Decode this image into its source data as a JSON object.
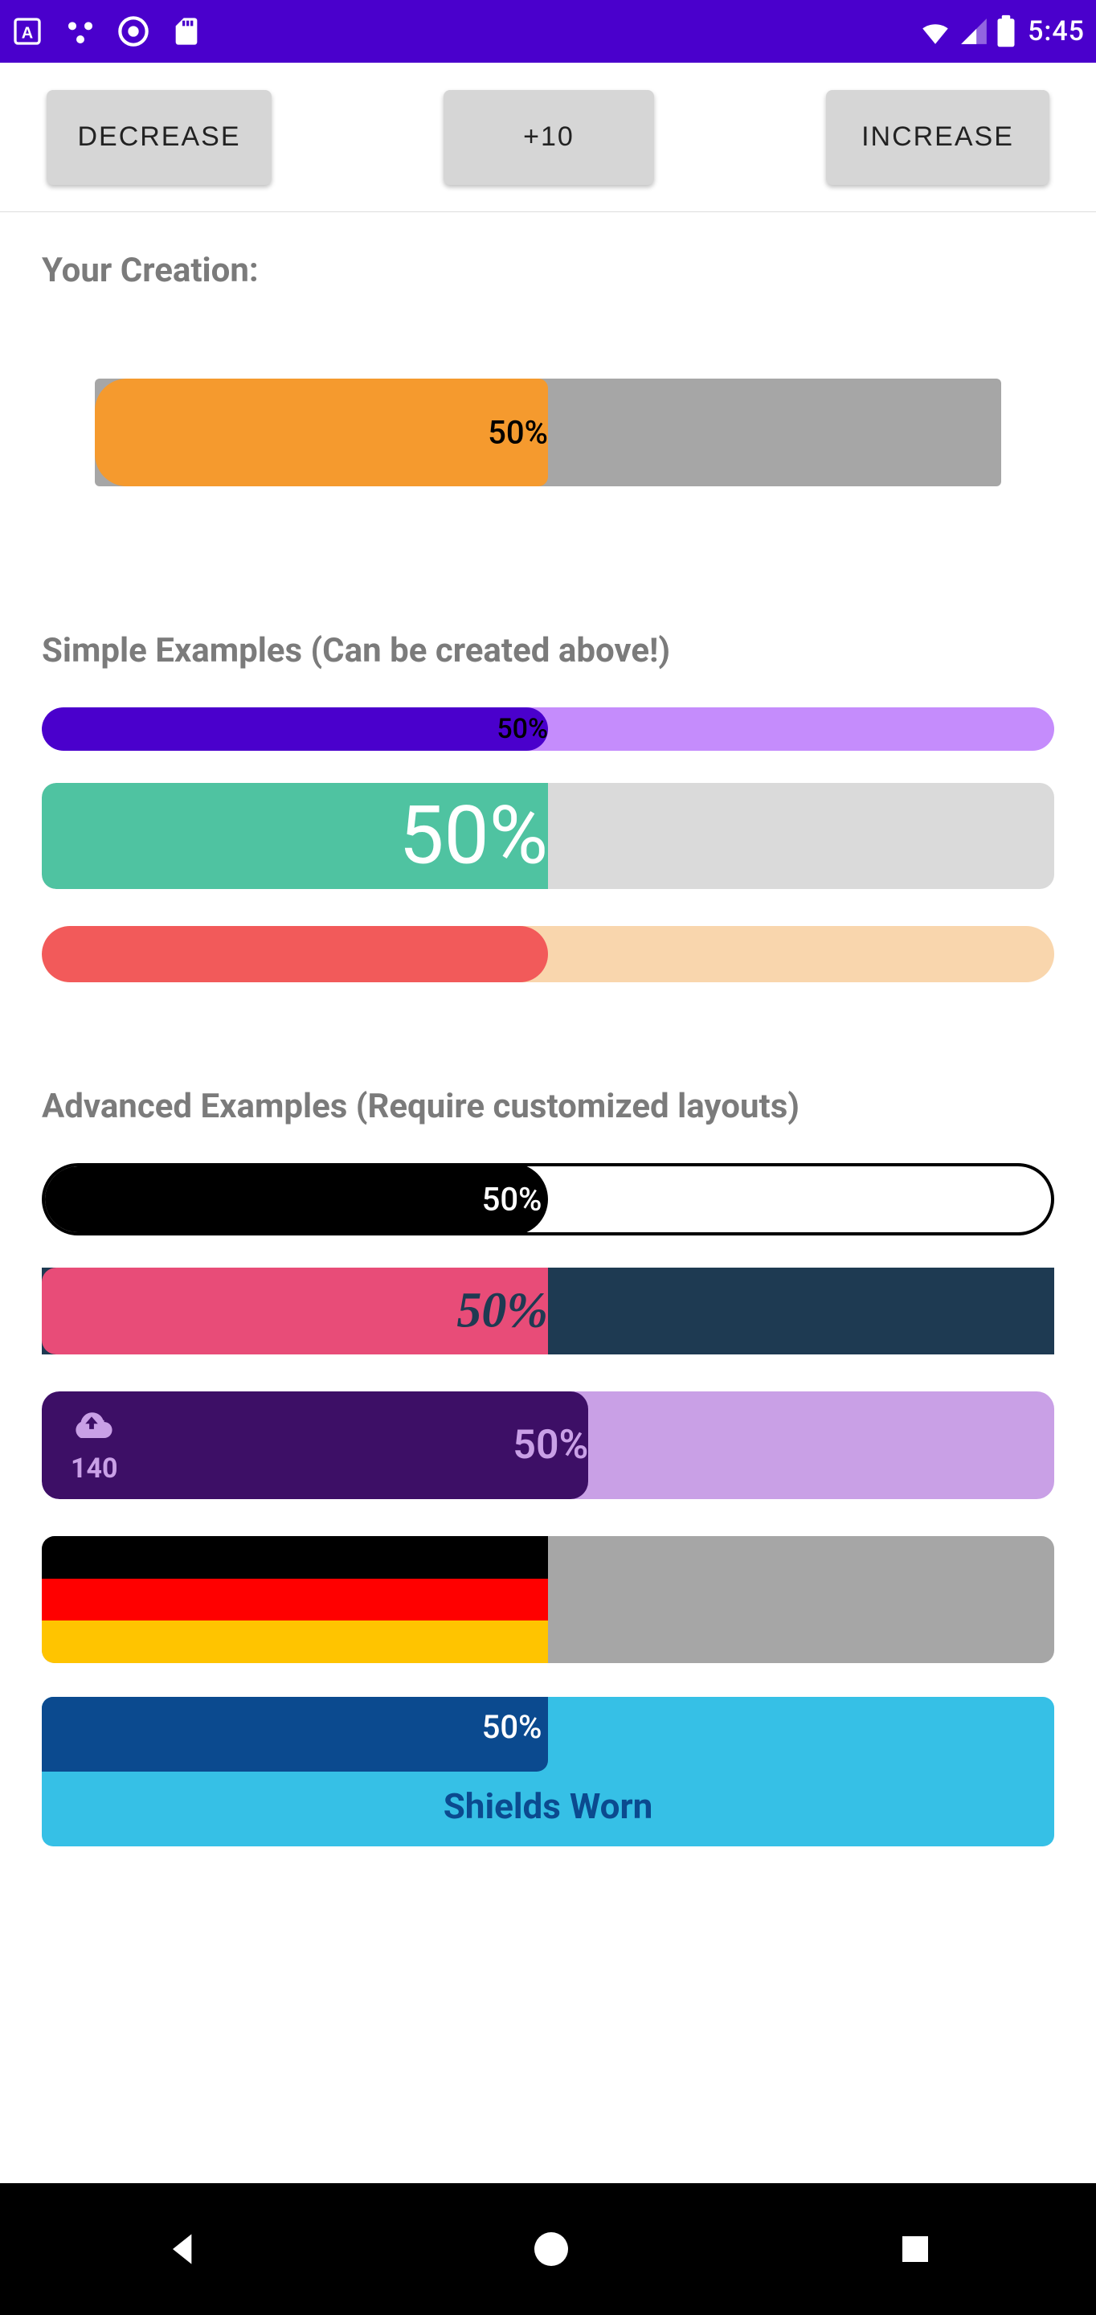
{
  "statusbar": {
    "time": "5:45"
  },
  "toolbar": {
    "decrease_label": "DECREASE",
    "plus10_label": "+10",
    "increase_label": "INCREASE"
  },
  "headings": {
    "creation": "Your Creation:",
    "simple": "Simple Examples (Can be created above!)",
    "advanced": "Advanced Examples (Require customized layouts)"
  },
  "bars": {
    "creation_pct": "50%",
    "simple1_pct": "50%",
    "simple2_pct": "50%",
    "adv1_pct": "50%",
    "adv2_pct": "50%",
    "adv3_pct": "50%",
    "adv3_num": "140",
    "adv5_pct": "50%",
    "adv5_label": "Shields Worn"
  }
}
